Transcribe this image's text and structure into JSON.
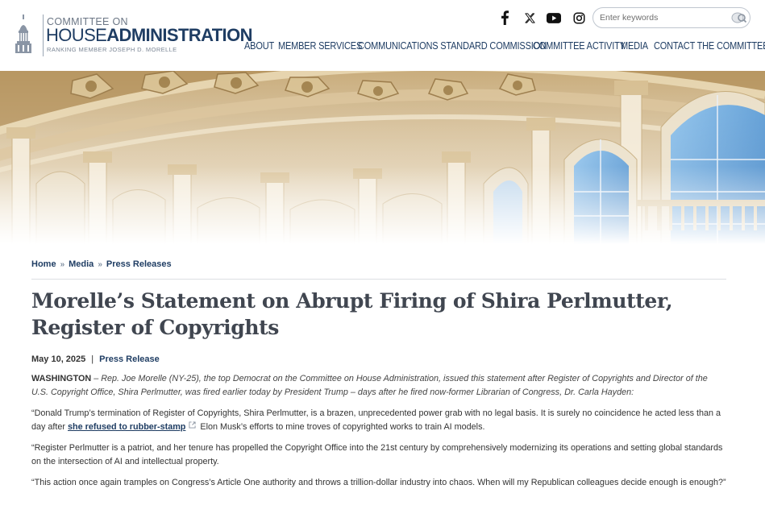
{
  "header": {
    "logo": {
      "line1": "COMMITTEE ON",
      "line2_light": "HOUSE",
      "line2_bold": "ADMINISTRATION",
      "line3": "RANKING MEMBER JOSEPH D. MORELLE"
    },
    "social_icons": [
      "facebook-icon",
      "x-icon",
      "youtube-icon",
      "instagram-icon"
    ],
    "search": {
      "placeholder": "Enter keywords",
      "value": ""
    },
    "nav": [
      "ABOUT",
      "MEMBER SERVICES",
      "COMMUNICATIONS STANDARD COMMISSION",
      "COMMITTEE ACTIVITY",
      "MEDIA",
      "CONTACT THE COMMITTEE"
    ]
  },
  "breadcrumb": [
    "Home",
    "Media",
    "Press Releases"
  ],
  "article": {
    "title": "Morelle’s Statement on Abrupt Firing of Shira Perlmutter, Register of Copyrights",
    "date": "May 10, 2025",
    "category": "Press Release",
    "dateline": "WASHINGTON",
    "intro": "– Rep. Joe Morelle (NY-25), the top Democrat on the Committee on House Administration, issued this statement after Register of Copyrights and Director of the U.S. Copyright Office, Shira Perlmutter, was fired earlier today by President Trump – days after he fired now-former Librarian of Congress, Dr. Carla Hayden:",
    "p1_before": "“Donald Trump’s termination of Register of Copyrights, Shira Perlmutter, is a brazen, unprecedented power grab with no legal basis. It is surely no coincidence he acted less than a day after",
    "p1_link": "she refused to rubber-stamp",
    "p1_after": "Elon Musk’s efforts to mine troves of copyrighted works to train AI models.",
    "p2": "“Register Perlmutter is a patriot, and her tenure has propelled the Copyright Office into the 21st century by comprehensively modernizing its operations and setting global standards on the intersection of AI and intellectual property.",
    "p3": "“This action once again tramples on Congress’s Article One authority and throws a trillion-dollar industry into chaos. When will my Republican colleagues decide enough is enough?”"
  },
  "colors": {
    "navy": "#1f3d63",
    "title_gray": "#404650",
    "hero_cream": "#e9dcc3",
    "window_blue": "#3f86c8"
  }
}
